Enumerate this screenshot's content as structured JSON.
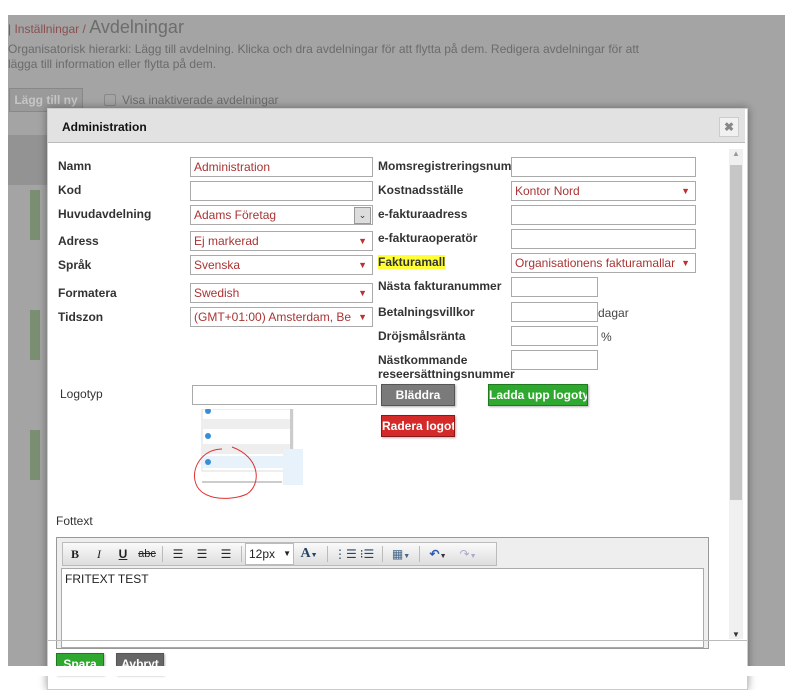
{
  "page": {
    "breadcrumb_link": "Inställningar",
    "breadcrumb_sep": "/",
    "title": "Avdelningar",
    "description": "Organisatorisk hierarki: Lägg till avdelning. Klicka och dra avdelningar för att flytta på dem. Redigera avdelningar för att lägga till information eller flytta på dem.",
    "add_button": "Lägg till ny",
    "show_inactive": "Visa inaktiverade avdelningar"
  },
  "dialog": {
    "title": "Administration",
    "left": {
      "namn_label": "Namn",
      "namn_value": "Administration",
      "kod_label": "Kod",
      "kod_value": "",
      "huvud_label": "Huvudavdelning",
      "huvud_value": "Adams Företag",
      "adress_label": "Adress",
      "adress_value": "Ej markerad",
      "sprak_label": "Språk",
      "sprak_value": "Svenska",
      "formatera_label": "Formatera",
      "formatera_value": "Swedish",
      "tidszon_label": "Tidszon",
      "tidszon_value": "(GMT+01:00) Amsterdam, Be"
    },
    "right": {
      "moms_label": "Momsregistreringsnum",
      "kost_label": "Kostnadsställe",
      "kost_value": "Kontor Nord",
      "efaktura_label": "e-fakturaadress",
      "efop_label": "e-fakturaoperatör",
      "fakturamall_label": "Fakturamall",
      "fakturamall_value": "Organisationens fakturamallar",
      "nasta_label": "Nästa fakturanummer",
      "betal_label": "Betalningsvillkor",
      "betal_unit": "dagar",
      "drojs_label": "Dröjsmålsränta",
      "drojs_unit": "%",
      "nastk_label": "Nästkommande reseersättningsnummer"
    },
    "logo": {
      "label": "Logotyp",
      "browse": "Bläddra",
      "upload": "Ladda upp logotyp",
      "delete": "Radera logotyp"
    },
    "footer_text": {
      "label": "Fottext",
      "font_size": "12px",
      "content": "FRITEXT TEST"
    },
    "buttons": {
      "save": "Spara",
      "cancel": "Avbryt"
    },
    "colors": {
      "green": "#2ea82e",
      "red": "#d42a2a",
      "gray": "#777777",
      "highlight": "#ffff33"
    }
  }
}
